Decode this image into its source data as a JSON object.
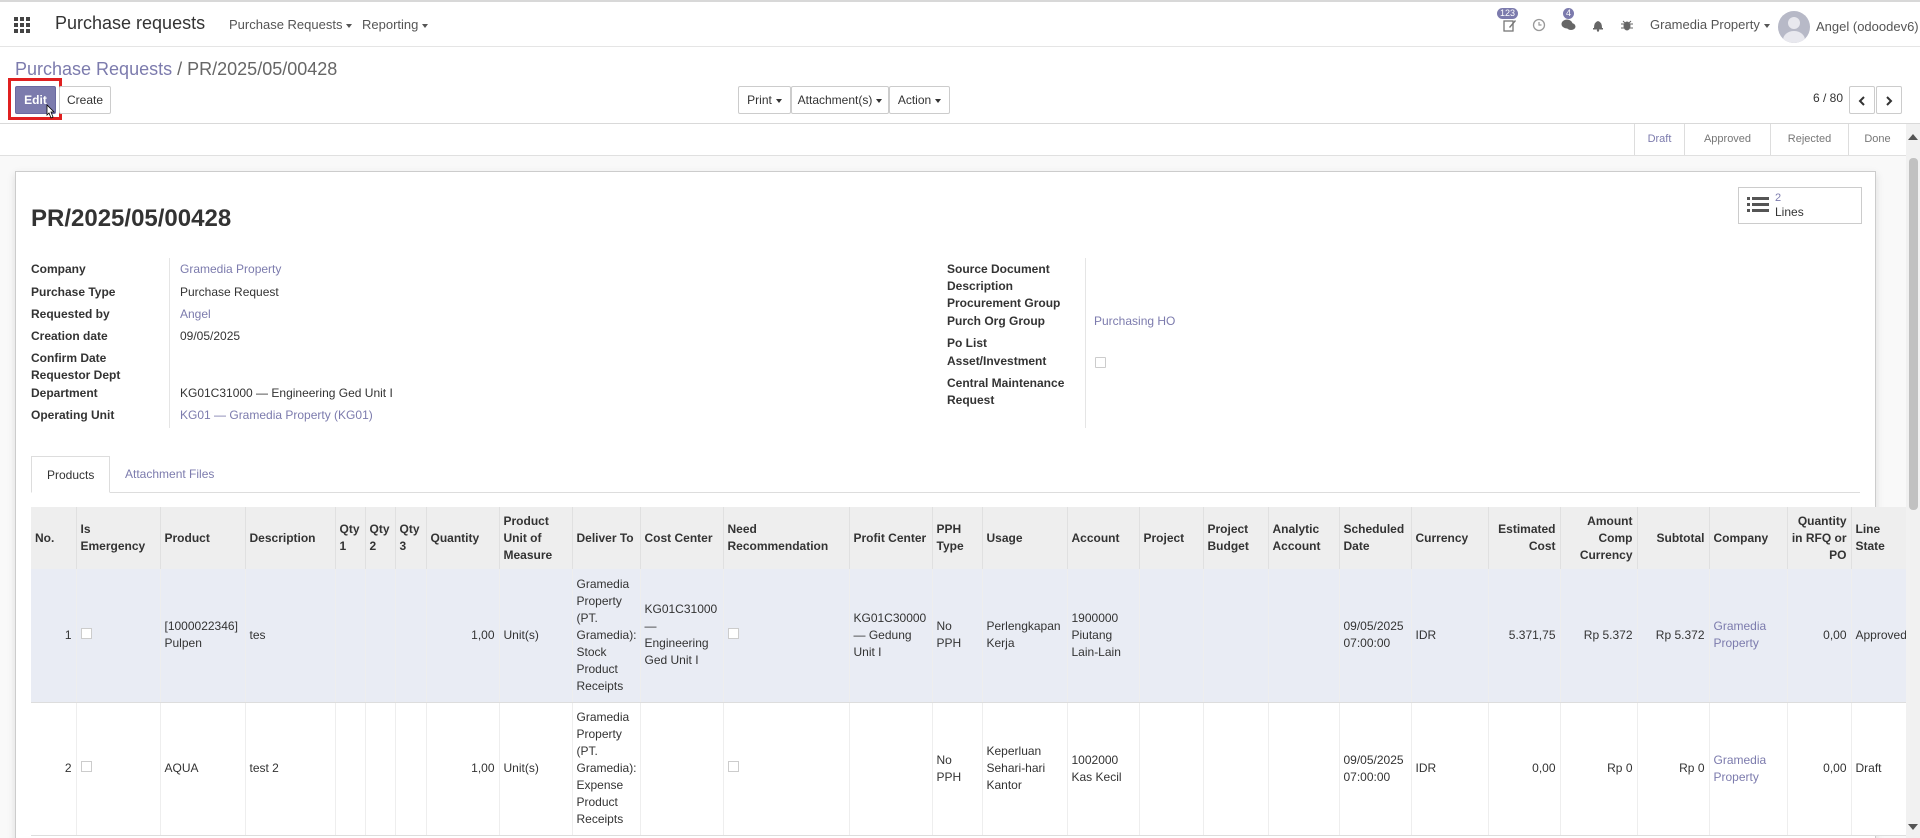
{
  "navbar": {
    "app_title": "Purchase requests",
    "menus": [
      "Purchase Requests",
      "Reporting"
    ],
    "badges": {
      "activity": "123",
      "messages": "4"
    },
    "company": "Gramedia Property",
    "user": "Angel (odoodev6)"
  },
  "breadcrumb": {
    "parent": "Purchase Requests",
    "separator": "/",
    "current": "PR/2025/05/00428"
  },
  "toolbar": {
    "edit": "Edit",
    "create": "Create",
    "print": "Print",
    "attachments": "Attachment(s)",
    "action": "Action",
    "pager": "6 / 80"
  },
  "stages": [
    "Draft",
    "Approved",
    "Rejected",
    "Done"
  ],
  "record": {
    "title": "PR/2025/05/00428",
    "smart_button": {
      "count": "2",
      "label": "Lines"
    },
    "left_fields": [
      {
        "label": "Company",
        "value": "Gramedia Property"
      },
      {
        "label": "Purchase Type",
        "value": "Purchase Request"
      },
      {
        "label": "Requested by",
        "value": "Angel"
      },
      {
        "label": "Creation date",
        "value": "09/05/2025"
      },
      {
        "label": "Confirm Date",
        "value": ""
      },
      {
        "label": "Requestor Dept",
        "value": ""
      },
      {
        "label": "Department",
        "value": "KG01C31000 — Engineering Ged Unit I"
      },
      {
        "label": "Operating Unit",
        "value": "KG01 — Gramedia Property (KG01)"
      }
    ],
    "right_fields": [
      {
        "label": "Source Document",
        "value": ""
      },
      {
        "label": "Description",
        "value": ""
      },
      {
        "label": "Procurement Group",
        "value": ""
      },
      {
        "label": "Purch Org Group",
        "value": "Purchasing HO"
      },
      {
        "label": "Po List",
        "value": ""
      },
      {
        "label": "Asset/Investment",
        "value": ""
      },
      {
        "label": "Central Maintenance Request",
        "value": ""
      }
    ]
  },
  "tabs": [
    "Products",
    "Attachment Files"
  ],
  "table": {
    "headers": [
      "No.",
      "Is Emergency",
      "Product",
      "Description",
      "Qty 1",
      "Qty 2",
      "Qty 3",
      "Quantity",
      "Product Unit of Measure",
      "Deliver To",
      "Cost Center",
      "Need Recommendation",
      "Profit Center",
      "PPH Type",
      "Usage",
      "Account",
      "Project",
      "Project Budget",
      "Analytic Account",
      "Scheduled Date",
      "Currency",
      "Estimated Cost",
      "Amount Comp Currency",
      "Subtotal",
      "Company",
      "Quantity in RFQ or PO",
      "Line State"
    ],
    "rows": [
      {
        "no": "1",
        "product": "[1000022346] Pulpen",
        "description": "tes",
        "quantity": "1,00",
        "uom": "Unit(s)",
        "deliver_to": "Gramedia Property (PT. Gramedia): Stock Product Receipts",
        "cost_center": "KG01C31000 — Engineering Ged Unit I",
        "profit_center": "KG01C30000 — Gedung Unit I",
        "pph": "No PPH",
        "usage": "Perlengkapan Kerja",
        "account": "1900000 Piutang Lain-Lain",
        "scheduled": "09/05/2025 07:00:00",
        "currency": "IDR",
        "est_cost": "5.371,75",
        "amount_comp": "Rp 5.372",
        "subtotal": "Rp 5.372",
        "company": "Gramedia Property",
        "qty_rfq": "0,00",
        "state": "Approved"
      },
      {
        "no": "2",
        "product": "AQUA",
        "description": "test 2",
        "quantity": "1,00",
        "uom": "Unit(s)",
        "deliver_to": "Gramedia Property (PT. Gramedia): Expense Product Receipts",
        "cost_center": "",
        "profit_center": "",
        "pph": "No PPH",
        "usage": "Keperluan Sehari-hari Kantor",
        "account": "1002000 Kas Kecil",
        "scheduled": "09/05/2025 07:00:00",
        "currency": "IDR",
        "est_cost": "0,00",
        "amount_comp": "Rp 0",
        "subtotal": "Rp 0",
        "company": "Gramedia Property",
        "qty_rfq": "0,00",
        "state": "Draft"
      }
    ]
  },
  "colors": {
    "accent": "#7c7bad",
    "highlight": "#e02020"
  }
}
